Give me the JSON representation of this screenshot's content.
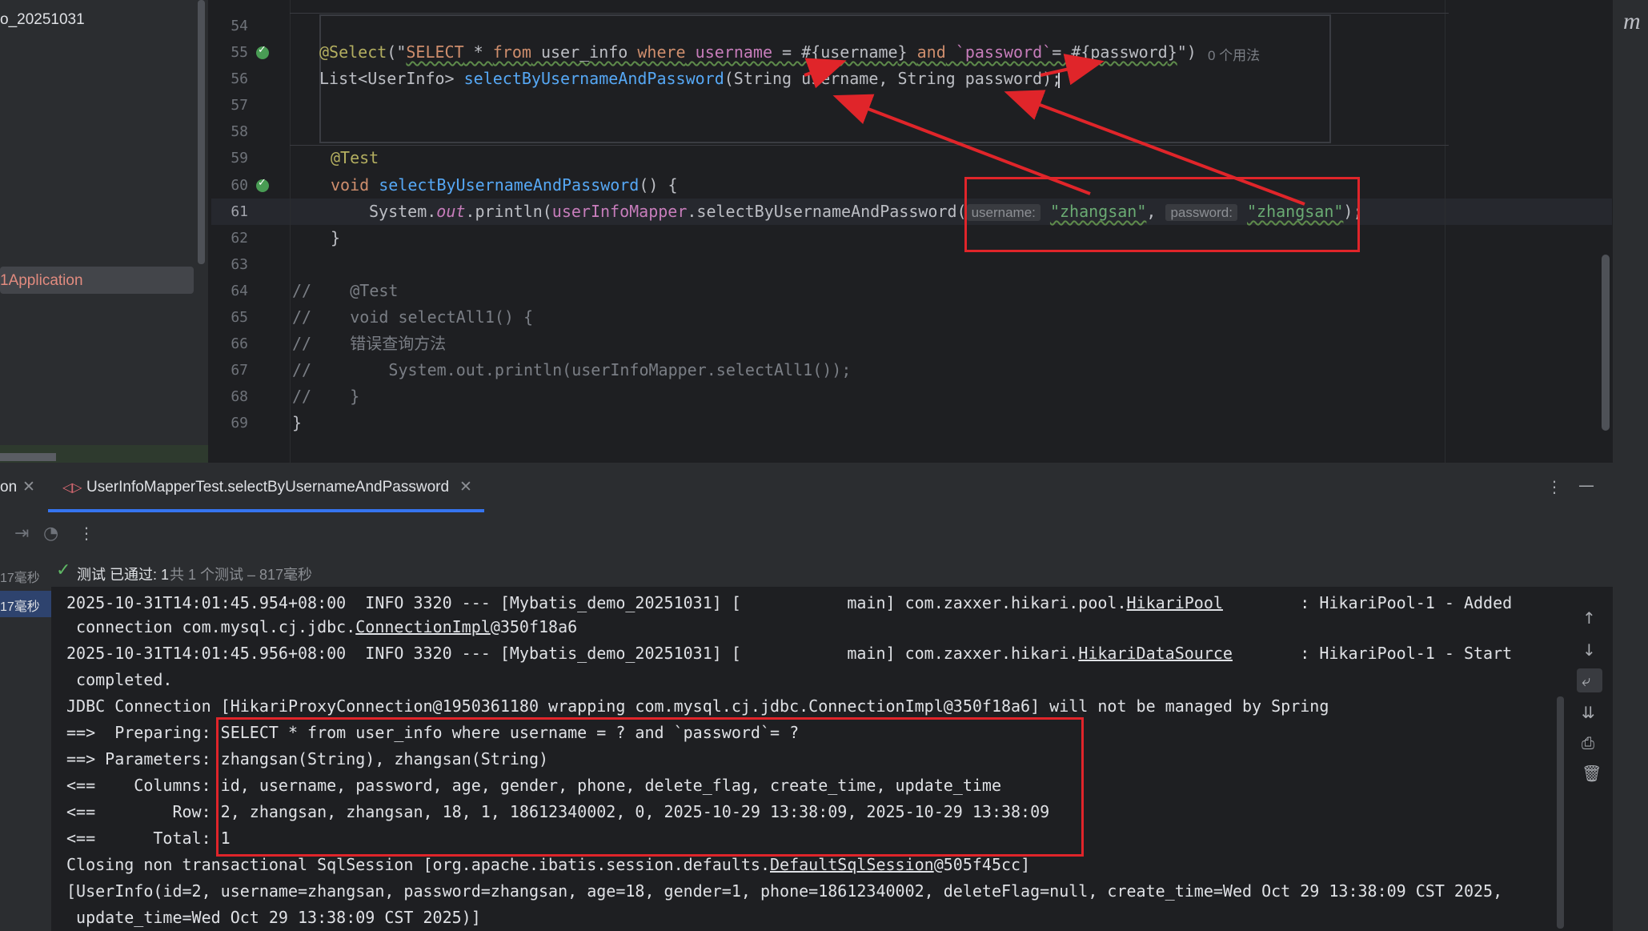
{
  "sidebar": {
    "project_name": "o_20251031",
    "selected_item": "1Application"
  },
  "editor": {
    "line_numbers": [
      "54",
      "55",
      "56",
      "57",
      "58",
      "59",
      "60",
      "61",
      "62",
      "63",
      "64",
      "65",
      "66",
      "67",
      "68",
      "69"
    ],
    "line55": {
      "annotation": "@Select",
      "open": "(\"",
      "sql_select": "SELECT",
      "sql_star": " * ",
      "sql_from": "from",
      "sql_table": " user_info ",
      "sql_where": "where",
      "sql_col1": " username ",
      "sql_eq1": "= #{",
      "sql_param1": "username",
      "sql_close1": "} ",
      "sql_and": "and",
      "sql_col2": " `password`",
      "sql_eq2": "= #{",
      "sql_param2": "password",
      "sql_close2": "}",
      "close": "\")",
      "usages": "0 个用法"
    },
    "line56": {
      "type": "List<UserInfo> ",
      "method": "selectByUsernameAndPassword",
      "params": "(String username, String password);"
    },
    "line59": "@Test",
    "line60": {
      "kw": "void ",
      "method": "selectByUsernameAndPassword",
      "rest": "() {"
    },
    "line61": {
      "sys": "System.",
      "out": "out",
      "println": ".println(",
      "mapper": "userInfoMapper",
      "call": ".selectByUsernameAndPassword(",
      "hint1": "username:",
      "arg1": "\"zhangsan\"",
      "comma": ", ",
      "hint2": "password:",
      "arg2": "\"zhangsan\"",
      "end": ");"
    },
    "line62": "}",
    "line64": "//    @Test",
    "line65": "//    void selectAll1() {",
    "line66": "//    错误查询方法",
    "line67": "//        System.out.println(userInfoMapper.selectAll1());",
    "line68": "//    }",
    "line69": "}"
  },
  "run_panel": {
    "tab_prev": "on",
    "tab_active": "UserInfoMapperTest.selectByUsernameAndPassword",
    "status_pass": "测试 已通过: 1",
    "status_detail": "共 1 个测试 – 817毫秒",
    "tree_time1": "17毫秒",
    "tree_time2": "17毫秒"
  },
  "console": {
    "l1": "2025-10-31T14:01:45.954+08:00  INFO 3320 --- [Mybatis_demo_20251031] [           main] com.zaxxer.hikari.pool.",
    "l1_link": "HikariPool",
    "l1_tail": "        : HikariPool-1 - Added",
    "l2_pre": " connection com.mysql.cj.jdbc.",
    "l2_link": "ConnectionImpl",
    "l2_tail": "@350f18a6",
    "l3": "2025-10-31T14:01:45.956+08:00  INFO 3320 --- [Mybatis_demo_20251031] [           main] com.zaxxer.hikari.",
    "l3_link": "HikariDataSource",
    "l3_tail": "       : HikariPool-1 - Start",
    "l4": " completed.",
    "l5": "JDBC Connection [HikariProxyConnection@1950361180 wrapping com.mysql.cj.jdbc.ConnectionImpl@350f18a6] will not be managed by Spring",
    "l6": "==>  Preparing: SELECT * from user_info where username = ? and `password`= ?",
    "l7": "==> Parameters: zhangsan(String), zhangsan(String)",
    "l8": "<==    Columns: id, username, password, age, gender, phone, delete_flag, create_time, update_time",
    "l9": "<==        Row: 2, zhangsan, zhangsan, 18, 1, 18612340002, 0, 2025-10-29 13:38:09, 2025-10-29 13:38:09",
    "l10": "<==      Total: 1",
    "l11_pre": "Closing non transactional SqlSession [org.apache.ibatis.session.defaults.",
    "l11_link": "DefaultSqlSession",
    "l11_tail": "@505f45cc]",
    "l12": "[UserInfo(id=2, username=zhangsan, password=zhangsan, age=18, gender=1, phone=18612340002, deleteFlag=null, create_time=Wed Oct 29 13:38:09 CST 2025,",
    "l13": " update_time=Wed Oct 29 13:38:09 CST 2025)]"
  },
  "right_stripe_letter": "m",
  "colors": {
    "annotation_red": "#e0252a",
    "accent_blue": "#3574f0",
    "pass_green": "#5fb865"
  }
}
